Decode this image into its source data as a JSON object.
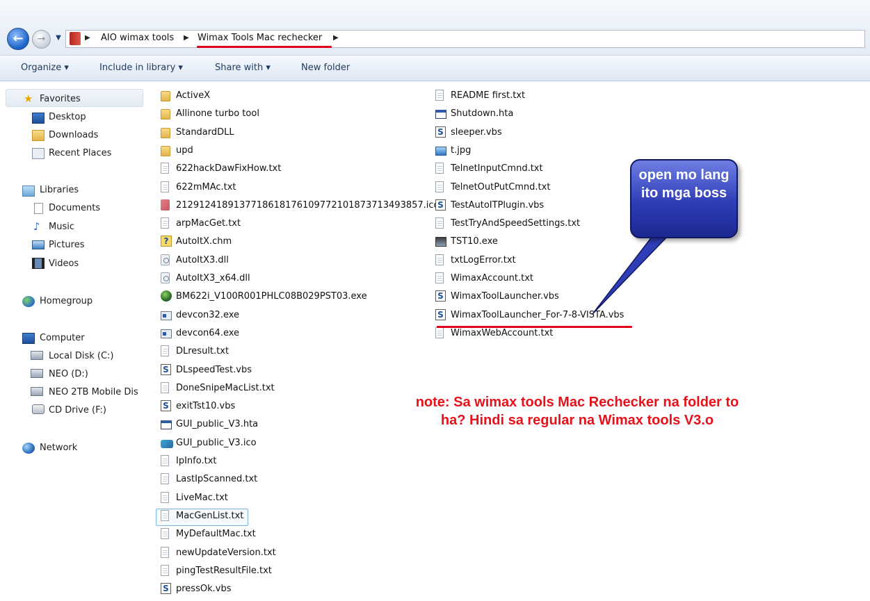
{
  "address": {
    "crumbs": [
      "AIO wimax tools",
      "Wimax Tools Mac rechecker"
    ]
  },
  "toolbar": {
    "organize": "Organize ▾",
    "include": "Include in library ▾",
    "share": "Share with ▾",
    "new_folder": "New folder"
  },
  "nav": {
    "favorites": "Favorites",
    "desktop": "Desktop",
    "downloads": "Downloads",
    "recent": "Recent Places",
    "libraries": "Libraries",
    "documents": "Documents",
    "music": "Music",
    "pictures": "Pictures",
    "videos": "Videos",
    "homegroup": "Homegroup",
    "computer": "Computer",
    "local_disk": "Local Disk (C:)",
    "neo": "NEO (D:)",
    "neo2tb": "NEO 2TB Mobile Dis",
    "cd": "CD Drive (F:)",
    "network": "Network"
  },
  "files_col1": [
    {
      "name": "ActiveX",
      "icon": "folder-icon"
    },
    {
      "name": "Allinone turbo tool",
      "icon": "folder-icon"
    },
    {
      "name": "StandardDLL",
      "icon": "folder-icon"
    },
    {
      "name": "upd",
      "icon": "folder-icon"
    },
    {
      "name": "622hackDawFixHow.txt",
      "icon": "text-file-icon"
    },
    {
      "name": "622mMAc.txt",
      "icon": "text-file-icon"
    },
    {
      "name": "2129124189137718618176109772101873713493857.ico",
      "icon": "ico-file-icon"
    },
    {
      "name": "arpMacGet.txt",
      "icon": "text-file-icon"
    },
    {
      "name": "AutoItX.chm",
      "icon": "help-file-icon"
    },
    {
      "name": "AutoItX3.dll",
      "icon": "dll-file-icon"
    },
    {
      "name": "AutoItX3_x64.dll",
      "icon": "dll-file-icon"
    },
    {
      "name": "BM622i_V100R001PHLC08B029PST03.exe",
      "icon": "globe-exe-icon"
    },
    {
      "name": "devcon32.exe",
      "icon": "exe-file-icon"
    },
    {
      "name": "devcon64.exe",
      "icon": "exe-file-icon"
    },
    {
      "name": "DLresult.txt",
      "icon": "text-file-icon"
    },
    {
      "name": "DLspeedTest.vbs",
      "icon": "script-file-icon"
    },
    {
      "name": "DoneSnipeMacList.txt",
      "icon": "text-file-icon"
    },
    {
      "name": "exitTst10.vbs",
      "icon": "script-file-icon"
    },
    {
      "name": "GUI_public_V3.hta",
      "icon": "hta-file-icon"
    },
    {
      "name": "GUI_public_V3.ico",
      "icon": "ico-image-icon"
    },
    {
      "name": "IpInfo.txt",
      "icon": "text-file-icon"
    },
    {
      "name": "LastIpScanned.txt",
      "icon": "text-file-icon"
    },
    {
      "name": "LiveMac.txt",
      "icon": "text-file-icon"
    },
    {
      "name": "MacGenList.txt",
      "icon": "text-file-icon"
    },
    {
      "name": "MyDefaultMac.txt",
      "icon": "text-file-icon"
    },
    {
      "name": "newUpdateVersion.txt",
      "icon": "text-file-icon"
    },
    {
      "name": "pingTestResultFile.txt",
      "icon": "text-file-icon"
    },
    {
      "name": "pressOk.vbs",
      "icon": "script-file-icon"
    }
  ],
  "files_col2": [
    {
      "name": "README first.txt",
      "icon": "text-file-icon"
    },
    {
      "name": "Shutdown.hta",
      "icon": "hta-file-icon"
    },
    {
      "name": "sleeper.vbs",
      "icon": "script-file-icon"
    },
    {
      "name": "t.jpg",
      "icon": "image-file-icon"
    },
    {
      "name": "TelnetInputCmnd.txt",
      "icon": "text-file-icon"
    },
    {
      "name": "TelnetOutPutCmnd.txt",
      "icon": "text-file-icon"
    },
    {
      "name": "TestAutoITPlugin.vbs",
      "icon": "script-file-icon"
    },
    {
      "name": "TestTryAndSpeedSettings.txt",
      "icon": "text-file-icon"
    },
    {
      "name": "TST10.exe",
      "icon": "tst-exe-icon"
    },
    {
      "name": "txtLogError.txt",
      "icon": "text-file-icon"
    },
    {
      "name": "WimaxAccount.txt",
      "icon": "text-file-icon"
    },
    {
      "name": "WimaxToolLauncher.vbs",
      "icon": "script-file-icon"
    },
    {
      "name": "WimaxToolLauncher_For-7-8-VISTA.vbs",
      "icon": "script-file-icon"
    },
    {
      "name": "WimaxWebAccount.txt",
      "icon": "text-file-icon"
    }
  ],
  "annotations": {
    "callout": "open mo lang ito mga boss",
    "note": "note: Sa wimax tools Mac Rechecker na folder to ha? Hindi sa regular na Wimax tools V3.o"
  },
  "colors": {
    "annotation_red": "#e8111a",
    "callout_blue": "#2f3db6"
  }
}
